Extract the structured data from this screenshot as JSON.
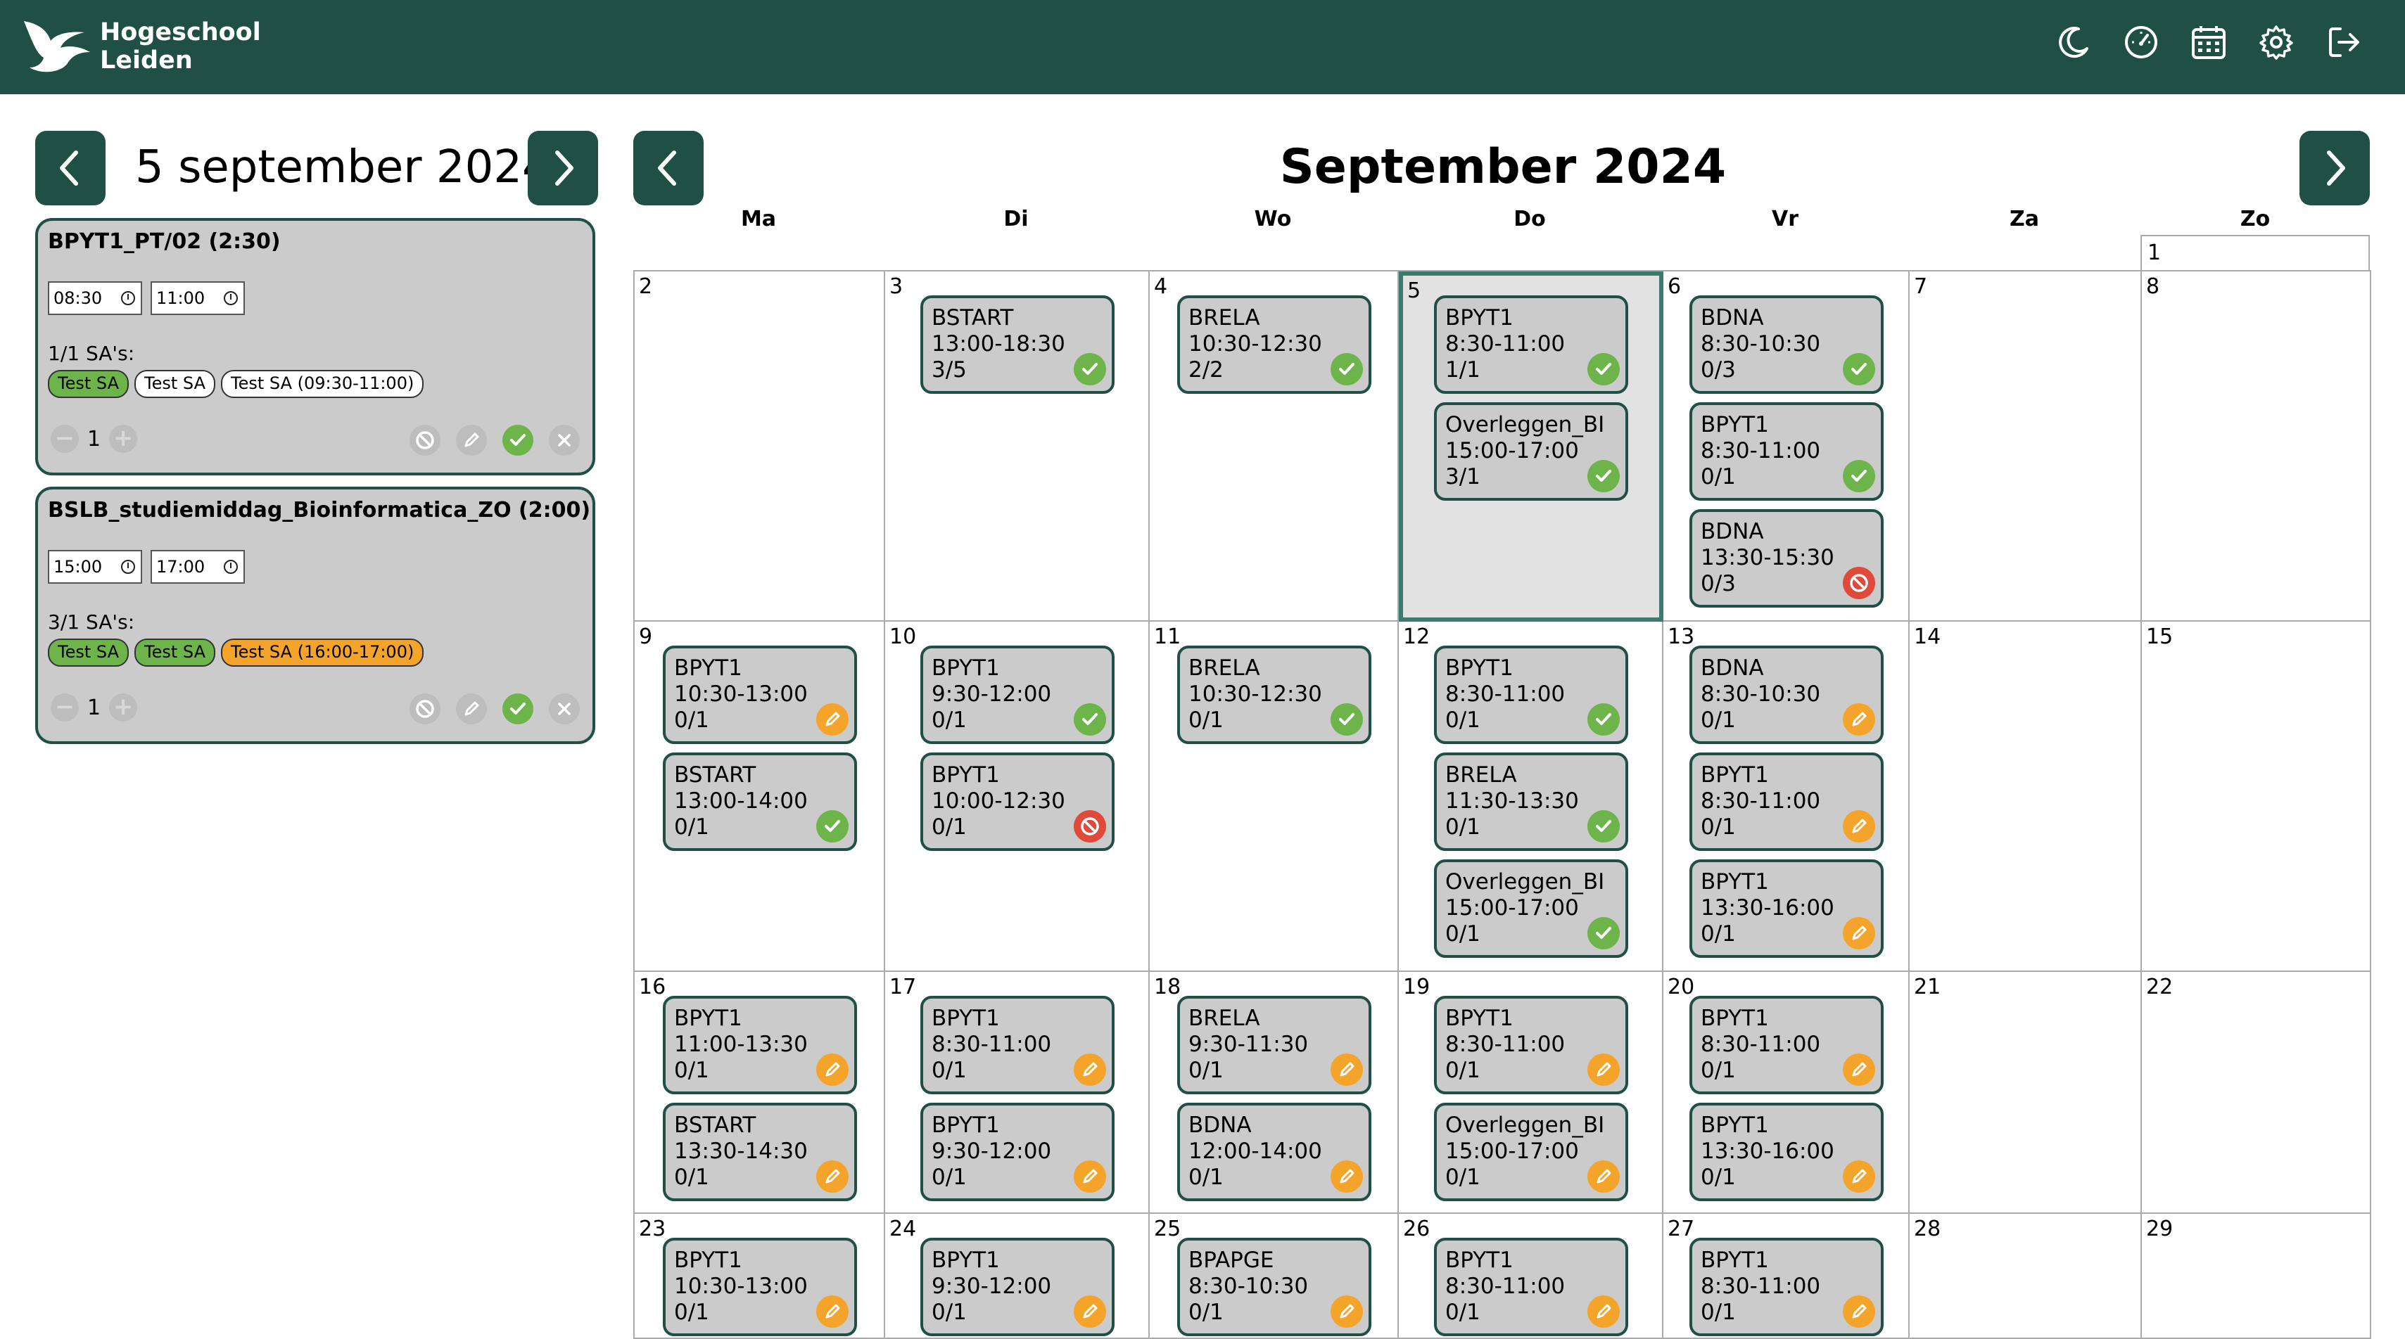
{
  "brand": {
    "line1": "Hogeschool",
    "line2": "Leiden"
  },
  "top_icons": [
    "moon-icon",
    "dashboard-icon",
    "calendar-icon",
    "gear-icon",
    "logout-icon"
  ],
  "colors": {
    "brand": "#1f4f45",
    "ok": "#6db54a",
    "pending": "#f4a42b",
    "blocked": "#e04a3a",
    "card": "#cbcbcb"
  },
  "day_panel": {
    "title": "5 september 2024",
    "tasks": [
      {
        "title": "BPYT1_PT/02 (2:30)",
        "start": "08:30",
        "end": "11:00",
        "sa_label": "1/1 SA's:",
        "chips": [
          {
            "text": "Test SA",
            "status": "green"
          },
          {
            "text": "Test SA",
            "status": "white"
          },
          {
            "text": "Test SA (09:30-11:00)",
            "status": "white"
          }
        ],
        "count": "1"
      },
      {
        "title": "BSLB_studiemiddag_Bioinformatica_ZO (2:00)",
        "start": "15:00",
        "end": "17:00",
        "sa_label": "3/1 SA's:",
        "chips": [
          {
            "text": "Test SA",
            "status": "green"
          },
          {
            "text": "Test SA",
            "status": "green"
          },
          {
            "text": "Test SA (16:00-17:00)",
            "status": "orange"
          }
        ],
        "count": "1"
      }
    ]
  },
  "calendar": {
    "title": "September 2024",
    "weekdays": [
      "Ma",
      "Di",
      "Wo",
      "Do",
      "Vr",
      "Za",
      "Zo"
    ],
    "extra_day": "1",
    "weeks": [
      [
        {
          "day": "2",
          "events": []
        },
        {
          "day": "3",
          "events": [
            {
              "code": "BSTART",
              "time": "13:00-18:30",
              "count": "3/5",
              "status": "ok"
            }
          ]
        },
        {
          "day": "4",
          "events": [
            {
              "code": "BRELA",
              "time": "10:30-12:30",
              "count": "2/2",
              "status": "ok"
            }
          ]
        },
        {
          "day": "5",
          "today": true,
          "events": [
            {
              "code": "BPYT1",
              "time": "8:30-11:00",
              "count": "1/1",
              "status": "ok"
            },
            {
              "code": "Overleggen_BI",
              "time": "15:00-17:00",
              "count": "3/1",
              "status": "ok"
            }
          ]
        },
        {
          "day": "6",
          "events": [
            {
              "code": "BDNA",
              "time": "8:30-10:30",
              "count": "0/3",
              "status": "ok"
            },
            {
              "code": "BPYT1",
              "time": "8:30-11:00",
              "count": "0/1",
              "status": "ok"
            },
            {
              "code": "BDNA",
              "time": "13:30-15:30",
              "count": "0/3",
              "status": "no"
            }
          ]
        },
        {
          "day": "7",
          "events": []
        },
        {
          "day": "8",
          "events": []
        }
      ],
      [
        {
          "day": "9",
          "events": [
            {
              "code": "BPYT1",
              "time": "10:30-13:00",
              "count": "0/1",
              "status": "pend"
            },
            {
              "code": "BSTART",
              "time": "13:00-14:00",
              "count": "0/1",
              "status": "ok"
            }
          ]
        },
        {
          "day": "10",
          "events": [
            {
              "code": "BPYT1",
              "time": "9:30-12:00",
              "count": "0/1",
              "status": "ok"
            },
            {
              "code": "BPYT1",
              "time": "10:00-12:30",
              "count": "0/1",
              "status": "no"
            }
          ]
        },
        {
          "day": "11",
          "events": [
            {
              "code": "BRELA",
              "time": "10:30-12:30",
              "count": "0/1",
              "status": "ok"
            }
          ]
        },
        {
          "day": "12",
          "events": [
            {
              "code": "BPYT1",
              "time": "8:30-11:00",
              "count": "0/1",
              "status": "ok"
            },
            {
              "code": "BRELA",
              "time": "11:30-13:30",
              "count": "0/1",
              "status": "ok"
            },
            {
              "code": "Overleggen_BI",
              "time": "15:00-17:00",
              "count": "0/1",
              "status": "ok"
            }
          ]
        },
        {
          "day": "13",
          "events": [
            {
              "code": "BDNA",
              "time": "8:30-10:30",
              "count": "0/1",
              "status": "pend"
            },
            {
              "code": "BPYT1",
              "time": "8:30-11:00",
              "count": "0/1",
              "status": "pend"
            },
            {
              "code": "BPYT1",
              "time": "13:30-16:00",
              "count": "0/1",
              "status": "pend"
            }
          ]
        },
        {
          "day": "14",
          "events": []
        },
        {
          "day": "15",
          "events": []
        }
      ],
      [
        {
          "day": "16",
          "events": [
            {
              "code": "BPYT1",
              "time": "11:00-13:30",
              "count": "0/1",
              "status": "pend"
            },
            {
              "code": "BSTART",
              "time": "13:30-14:30",
              "count": "0/1",
              "status": "pend"
            }
          ]
        },
        {
          "day": "17",
          "events": [
            {
              "code": "BPYT1",
              "time": "8:30-11:00",
              "count": "0/1",
              "status": "pend"
            },
            {
              "code": "BPYT1",
              "time": "9:30-12:00",
              "count": "0/1",
              "status": "pend"
            }
          ]
        },
        {
          "day": "18",
          "events": [
            {
              "code": "BRELA",
              "time": "9:30-11:30",
              "count": "0/1",
              "status": "pend"
            },
            {
              "code": "BDNA",
              "time": "12:00-14:00",
              "count": "0/1",
              "status": "pend"
            }
          ]
        },
        {
          "day": "19",
          "events": [
            {
              "code": "BPYT1",
              "time": "8:30-11:00",
              "count": "0/1",
              "status": "pend"
            },
            {
              "code": "Overleggen_BI",
              "time": "15:00-17:00",
              "count": "0/1",
              "status": "pend"
            }
          ]
        },
        {
          "day": "20",
          "events": [
            {
              "code": "BPYT1",
              "time": "8:30-11:00",
              "count": "0/1",
              "status": "pend"
            },
            {
              "code": "BPYT1",
              "time": "13:30-16:00",
              "count": "0/1",
              "status": "pend"
            }
          ]
        },
        {
          "day": "21",
          "events": []
        },
        {
          "day": "22",
          "events": []
        }
      ],
      [
        {
          "day": "23",
          "events": [
            {
              "code": "BPYT1",
              "time": "10:30-13:00",
              "count": "0/1",
              "status": "pend"
            }
          ]
        },
        {
          "day": "24",
          "events": [
            {
              "code": "BPYT1",
              "time": "9:30-12:00",
              "count": "0/1",
              "status": "pend"
            }
          ]
        },
        {
          "day": "25",
          "events": [
            {
              "code": "BPAPGE",
              "time": "8:30-10:30",
              "count": "0/1",
              "status": "pend"
            }
          ]
        },
        {
          "day": "26",
          "events": [
            {
              "code": "BPYT1",
              "time": "8:30-11:00",
              "count": "0/1",
              "status": "pend"
            }
          ]
        },
        {
          "day": "27",
          "events": [
            {
              "code": "BPYT1",
              "time": "8:30-11:00",
              "count": "0/1",
              "status": "pend"
            }
          ]
        },
        {
          "day": "28",
          "events": []
        },
        {
          "day": "29",
          "events": []
        }
      ]
    ]
  }
}
